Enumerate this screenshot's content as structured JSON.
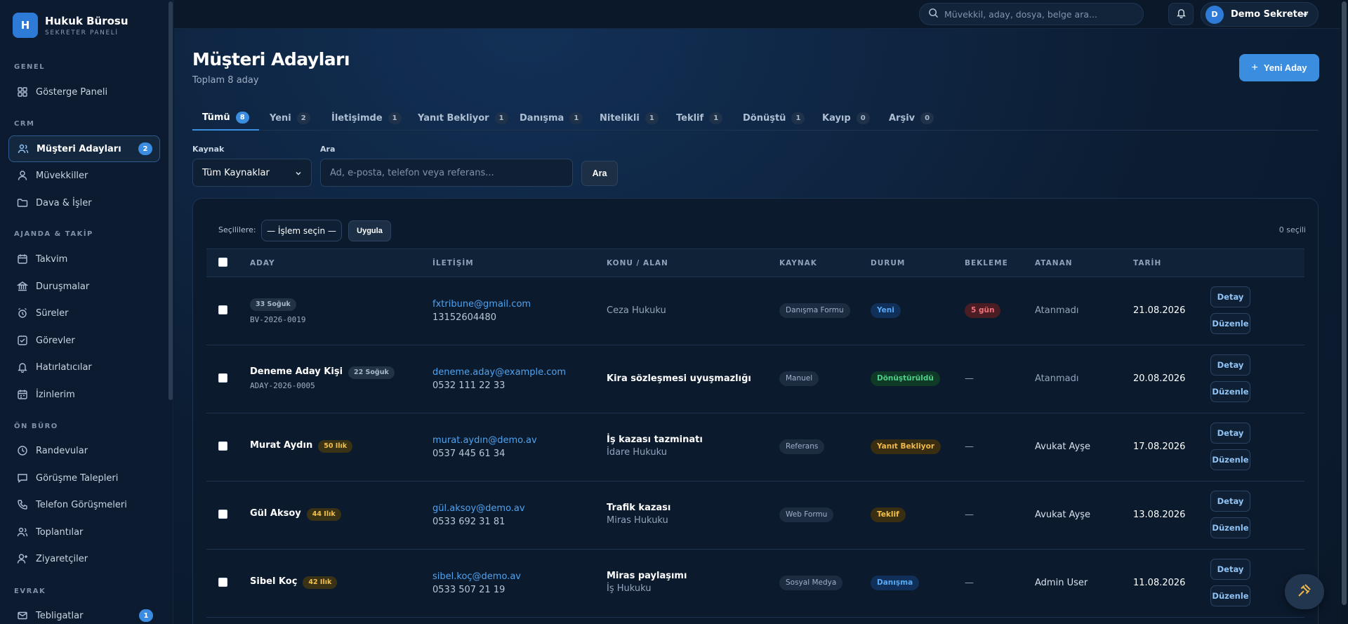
{
  "brand": {
    "logo": "H",
    "title": "Hukuk Bürosu",
    "subtitle": "SEKRETER PANELİ"
  },
  "sidebar": {
    "sections": [
      {
        "label": "GENEL"
      },
      {
        "label": "CRM"
      },
      {
        "label": "AJANDA & TAKİP"
      },
      {
        "label": "ÖN BÜRO"
      },
      {
        "label": "EVRAK"
      }
    ],
    "items": [
      {
        "label": "Gösterge Paneli",
        "icon": "grid-icon"
      },
      {
        "label": "Müşteri Adayları",
        "icon": "users-icon",
        "badge": "2",
        "active": true
      },
      {
        "label": "Müvekkiller",
        "icon": "user-icon"
      },
      {
        "label": "Dava & İşler",
        "icon": "folder-icon"
      },
      {
        "label": "Takvim",
        "icon": "calendar-icon"
      },
      {
        "label": "Duruşmalar",
        "icon": "courthouse-icon"
      },
      {
        "label": "Süreler",
        "icon": "alarm-clock-icon"
      },
      {
        "label": "Görevler",
        "icon": "checkbox-icon"
      },
      {
        "label": "Hatırlatıcılar",
        "icon": "bell-icon"
      },
      {
        "label": "İzinlerim",
        "icon": "calendar-days-icon"
      },
      {
        "label": "Randevular",
        "icon": "clock-icon"
      },
      {
        "label": "Görüşme Talepleri",
        "icon": "chat-icon"
      },
      {
        "label": "Telefon Görüşmeleri",
        "icon": "phone-icon"
      },
      {
        "label": "Toplantılar",
        "icon": "meeting-icon"
      },
      {
        "label": "Ziyaretçiler",
        "icon": "user-plus-icon"
      },
      {
        "label": "Tebligatlar",
        "icon": "mail-icon",
        "badge": "1"
      }
    ]
  },
  "topbar": {
    "search_placeholder": "Müvekkil, aday, dosya, belge ara...",
    "user_initial": "D",
    "user_name": "Demo Sekreter"
  },
  "page": {
    "title": "Müşteri Adayları",
    "subtitle": "Toplam 8 aday",
    "new_button": "Yeni Aday"
  },
  "tabs": [
    {
      "label": "Tümü",
      "count": "8"
    },
    {
      "label": "Yeni",
      "count": "2"
    },
    {
      "label": "İletişimde",
      "count": "1"
    },
    {
      "label": "Yanıt Bekliyor",
      "count": "1"
    },
    {
      "label": "Danışma",
      "count": "1"
    },
    {
      "label": "Nitelikli",
      "count": "1"
    },
    {
      "label": "Teklif",
      "count": "1"
    },
    {
      "label": "Dönüştü",
      "count": "1"
    },
    {
      "label": "Kayıp",
      "count": "0"
    },
    {
      "label": "Arşiv",
      "count": "0"
    }
  ],
  "filters": {
    "source_label": "Kaynak",
    "source_value": "Tüm Kaynaklar",
    "search_label": "Ara",
    "search_placeholder": "Ad, e-posta, telefon veya referans...",
    "search_button": "Ara"
  },
  "bulk": {
    "label": "Seçililere:",
    "select_value": "— İşlem seçin —",
    "apply": "Uygula",
    "selected_count": "0 seçili"
  },
  "table": {
    "headers": [
      "ADAY",
      "İLETİŞİM",
      "KONU / ALAN",
      "KAYNAK",
      "DURUM",
      "BEKLEME",
      "ATANAN",
      "TARİH"
    ],
    "detail_label": "Detay",
    "edit_label": "Düzenle",
    "rows": [
      {
        "name": "",
        "score": "33 Soğuk",
        "ref": "BV-2026-0019",
        "email": "fxtribune@gmail.com",
        "phone": "13152604480",
        "subject": "",
        "area": "Ceza Hukuku",
        "source": "Danışma Formu",
        "status": "Yeni",
        "wait": "5 gün",
        "assignee": "Atanmadı",
        "date": "21.08.2026"
      },
      {
        "name": "Deneme Aday Kişi",
        "score": "22 Soğuk",
        "ref": "ADAY-2026-0005",
        "email": "deneme.aday@example.com",
        "phone": "0532 111 22 33",
        "subject": "Kira sözleşmesi uyuşmazlığı",
        "area": "",
        "source": "Manuel",
        "status": "Dönüştürüldü",
        "wait": "—",
        "assignee": "Atanmadı",
        "date": "20.08.2026"
      },
      {
        "name": "Murat Aydın",
        "score": "50 Ilık",
        "ref": "",
        "email": "murat.aydın@demo.av",
        "phone": "0537 445 61 34",
        "subject": "İş kazası tazminatı",
        "area": "İdare Hukuku",
        "source": "Referans",
        "status": "Yanıt Bekliyor",
        "wait": "—",
        "assignee": "Avukat Ayşe",
        "date": "17.08.2026"
      },
      {
        "name": "Gül Aksoy",
        "score": "44 Ilık",
        "ref": "",
        "email": "gül.aksoy@demo.av",
        "phone": "0533 692 31 81",
        "subject": "Trafik kazası",
        "area": "Miras Hukuku",
        "source": "Web Formu",
        "status": "Teklif",
        "wait": "—",
        "assignee": "Avukat Ayşe",
        "date": "13.08.2026"
      },
      {
        "name": "Sibel Koç",
        "score": "42 Ilık",
        "ref": "",
        "email": "sibel.koç@demo.av",
        "phone": "0533 507 21 19",
        "subject": "Miras paylaşımı",
        "area": "İş Hukuku",
        "source": "Sosyal Medya",
        "status": "Danışma",
        "wait": "—",
        "assignee": "Admin User",
        "date": "11.08.2026"
      }
    ]
  },
  "colors": {
    "accent": "#3b8de0",
    "background": "#0b1a2e"
  }
}
